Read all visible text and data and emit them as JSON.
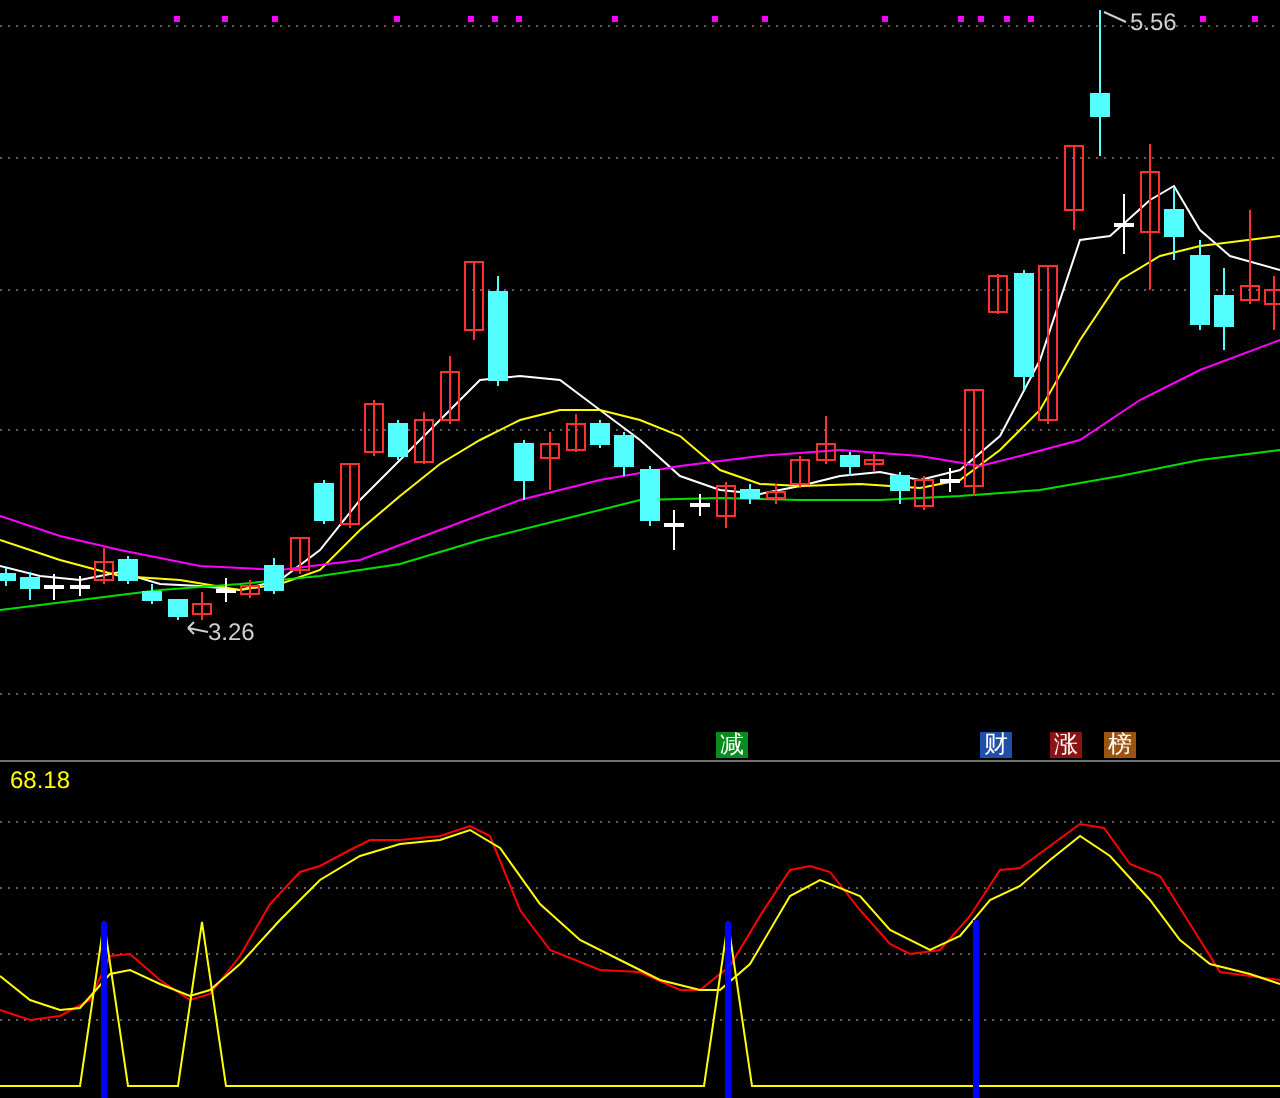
{
  "price_chart": {
    "high_label": "5.56",
    "low_label": "3.26",
    "signals": [
      {
        "text": "减",
        "color": "#0b8a1e"
      },
      {
        "text": "财",
        "color": "#1f4fa8"
      },
      {
        "text": "涨",
        "color": "#8a1414"
      },
      {
        "text": "榜",
        "color": "#9a5410"
      }
    ]
  },
  "indicator_panel": {
    "reading": "68.18"
  }
}
